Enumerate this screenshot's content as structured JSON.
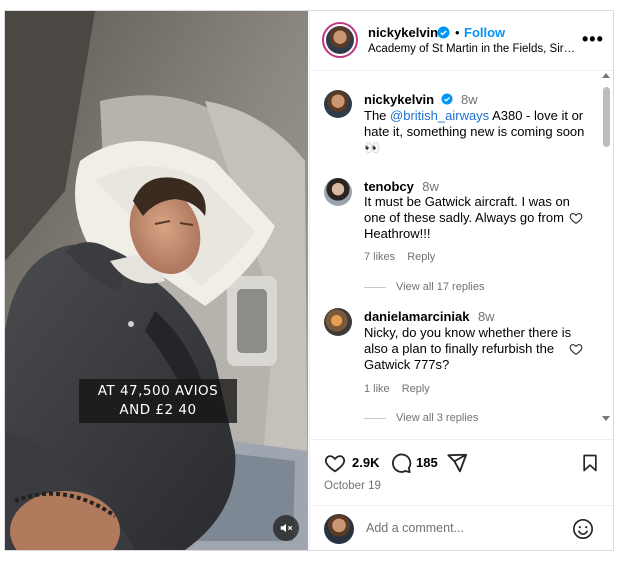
{
  "post": {
    "author": "nickykelvin",
    "follow_label": "Follow",
    "dot": "•",
    "location": "Academy of St Martin in the Fields, Sir N...",
    "more_label": "•••",
    "caption": {
      "author": "nickykelvin",
      "time": "8w",
      "text_before": "The ",
      "mention": "@british_airways",
      "text_after": " A380 - love it or hate it, something new is coming soon 👀"
    },
    "video_overlay_text": "AT 47,500 AVIOS AND £2 40"
  },
  "comments": [
    {
      "user": "tenobcy",
      "time": "8w",
      "text": "It must be Gatwick aircraft. I was on one of these sadly. Always go from Heathrow!!!",
      "likes": "7 likes",
      "reply_label": "Reply",
      "view_replies": "View all 17 replies"
    },
    {
      "user": "danielamarciniak",
      "time": "8w",
      "text": "Nicky, do you know whether there is also a plan to finally refurbish the Gatwick 777s?",
      "likes": "1 like",
      "reply_label": "Reply",
      "view_replies": "View all 3 replies"
    }
  ],
  "actions": {
    "like_count": "2.9K",
    "comment_count": "185",
    "date": "October 19"
  },
  "composer": {
    "placeholder": "Add a comment..."
  },
  "icons": {
    "verified": "verified-badge-icon",
    "like": "heart-icon",
    "comment": "comment-bubble-icon",
    "share": "paper-plane-icon",
    "save": "bookmark-icon",
    "emoji": "smiley-icon",
    "mute": "speaker-muted-icon"
  },
  "colors": {
    "link": "#0095f6",
    "text_secondary": "#737373",
    "border": "#dbdbdb"
  }
}
